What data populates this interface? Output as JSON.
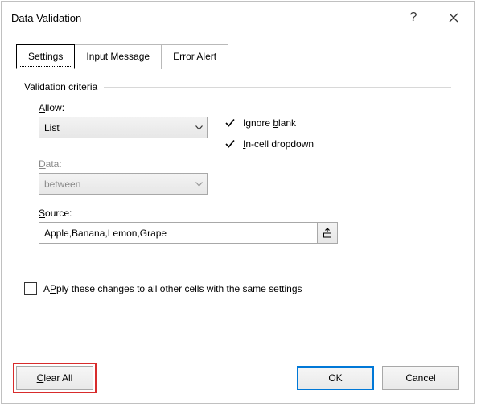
{
  "title": "Data Validation",
  "tabs": {
    "settings": "Settings",
    "input": "Input Message",
    "error": "Error Alert"
  },
  "fieldset": "Validation criteria",
  "allow": {
    "label_pre": "",
    "label_ul": "A",
    "label_post": "llow:",
    "value": "List"
  },
  "data": {
    "label_pre": "",
    "label_ul": "D",
    "label_post": "ata:",
    "value": "between"
  },
  "ignore_blank": {
    "pre": "Ignore ",
    "ul": "b",
    "post": "lank"
  },
  "incell": {
    "pre": "",
    "ul": "I",
    "post": "n-cell dropdown"
  },
  "source": {
    "label_pre": "",
    "label_ul": "S",
    "label_post": "ource:",
    "value": "Apple,Banana,Lemon,Grape"
  },
  "apply": {
    "pre": "Apply these changes to all other cells with the same settings",
    "ul": "P"
  },
  "buttons": {
    "clear_pre": "",
    "clear_ul": "C",
    "clear_post": "lear All",
    "ok": "OK",
    "cancel": "Cancel"
  }
}
